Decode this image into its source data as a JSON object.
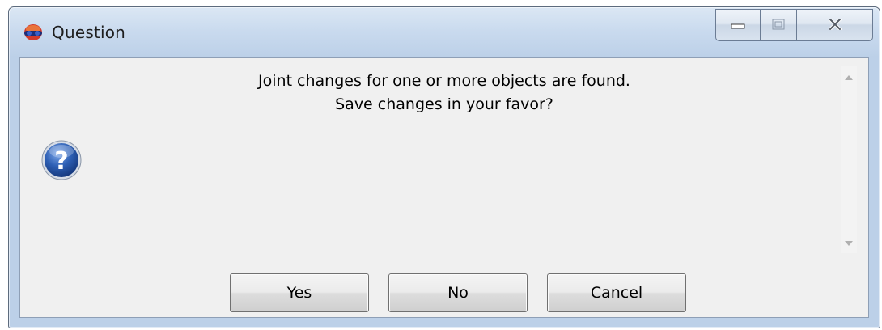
{
  "window": {
    "title": "Question",
    "app_icon": "app-logo-icon"
  },
  "caption_buttons": {
    "minimize_icon": "minimize-icon",
    "maximize_icon": "maximize-icon",
    "close_icon": "close-icon"
  },
  "dialog": {
    "icon": "question-icon",
    "message_line1": "Joint changes for one or more objects are found.",
    "message_line2": "Save changes in your favor?"
  },
  "buttons": {
    "yes_label": "Yes",
    "no_label": "No",
    "cancel_label": "Cancel"
  },
  "scrollbar": {
    "up_icon": "scroll-up-arrow-icon",
    "down_icon": "scroll-down-arrow-icon"
  },
  "colors": {
    "frame": "#bcd0e8",
    "client_bg": "#f0f0f0",
    "question_icon_blue": "#2d5fb4"
  }
}
